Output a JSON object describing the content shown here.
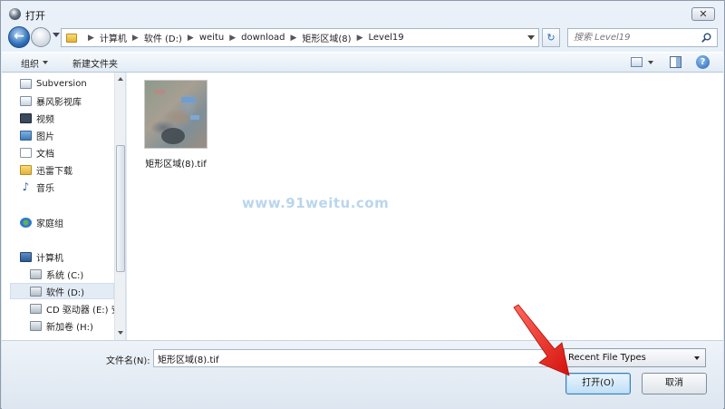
{
  "window": {
    "title": "打开",
    "close_label": "✕"
  },
  "address_bar": {
    "breadcrumbs": [
      "计算机",
      "软件 (D:)",
      "weitu",
      "download",
      "矩形区域(8)",
      "Level19"
    ],
    "search_placeholder": "搜索 Level19"
  },
  "toolbar": {
    "organize_label": "组织",
    "new_folder_label": "新建文件夹"
  },
  "sidebar": {
    "items": [
      {
        "label": "Subversion",
        "icon": "subversion-icon"
      },
      {
        "label": "暴风影视库",
        "icon": "video-library-icon"
      },
      {
        "label": "视频",
        "icon": "video-icon"
      },
      {
        "label": "图片",
        "icon": "pictures-icon"
      },
      {
        "label": "文档",
        "icon": "documents-icon"
      },
      {
        "label": "迅雷下载",
        "icon": "thunder-download-icon"
      },
      {
        "label": "音乐",
        "icon": "music-icon"
      },
      {
        "label": "家庭组",
        "icon": "homegroup-icon"
      },
      {
        "label": "计算机",
        "icon": "computer-icon"
      },
      {
        "label": "系统 (C:)",
        "icon": "drive-c-icon"
      },
      {
        "label": "软件 (D:)",
        "icon": "drive-d-icon"
      },
      {
        "label": "CD 驱动器 (E:) 安",
        "icon": "cd-drive-icon"
      },
      {
        "label": "新加卷 (H:)",
        "icon": "drive-h-icon"
      }
    ],
    "selected": "软件 (D:)"
  },
  "files": [
    {
      "name": "矩形区域(8).tif",
      "icon": "satellite-image-thumbnail"
    }
  ],
  "watermark": "www.91weitu.com",
  "bottom": {
    "filename_label": "文件名(N):",
    "filename_value": "矩形区域(8).tif",
    "file_type": "Recent File Types",
    "open_label": "打开(O)",
    "cancel_label": "取消"
  },
  "colors": {
    "annotation_arrow": "#e8221c",
    "watermark": "#b9d6ee"
  }
}
